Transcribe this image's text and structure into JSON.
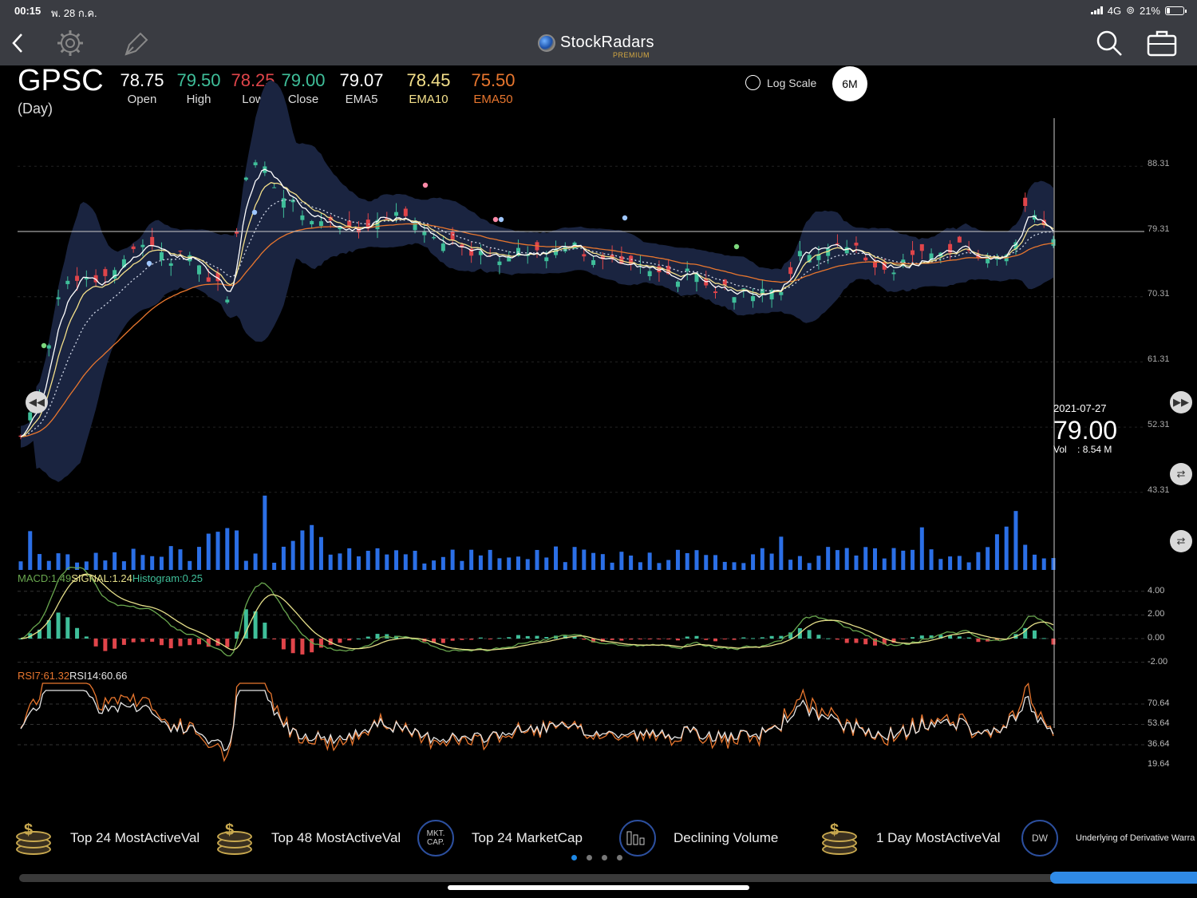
{
  "status_bar": {
    "time": "00:15",
    "date": "พ. 28 ก.ค.",
    "network": "4G",
    "battery": "21%",
    "battery_level": 0.21
  },
  "app": {
    "name": "StockRadars",
    "tier": "PREMIUM"
  },
  "quote": {
    "symbol": "GPSC",
    "period": "(Day)",
    "open": "78.75",
    "open_label": "Open",
    "high": "79.50",
    "high_label": "High",
    "low": "78.25",
    "low_label": "Low",
    "close": "79.00",
    "close_label": "Close",
    "ema5": "79.07",
    "ema5_label": "EMA5",
    "ema10": "78.45",
    "ema10_label": "EMA10",
    "ema50": "75.50",
    "ema50_label": "EMA50"
  },
  "controls": {
    "log_scale_label": "Log Scale",
    "log_scale_checked": false,
    "period": "6M"
  },
  "price_axis": {
    "ticks": [
      "88.31",
      "79.31",
      "70.31",
      "61.31",
      "52.31",
      "43.31"
    ]
  },
  "crosshair": {
    "date": "2021-07-27",
    "price": "79.00",
    "vol_label": "Vol",
    "vol_value": ": 8.54 M"
  },
  "macd": {
    "label_macd": "MACD:1.49",
    "label_signal": "SIGNAL:1.24",
    "label_hist": "Histogram:0.25",
    "ticks": [
      "4.00",
      "2.00",
      "0.00",
      "-2.00"
    ]
  },
  "rsi": {
    "label_rsi7": "RSI7:61.32",
    "label_rsi14": "RSI14:60.66",
    "ticks": [
      "70.64",
      "53.64",
      "36.64",
      "19.64"
    ]
  },
  "colors": {
    "up": "#3fbf9a",
    "down": "#e0454a",
    "ema5": "#ffffff",
    "ema10": "#f4e08a",
    "ema50": "#e8762e",
    "band": "#1a2440",
    "volume": "#2b6fe6",
    "macd_line": "#6aa84f",
    "signal_line": "#e6e08a",
    "rsi7": "#e8762e",
    "rsi14": "#e6e6e6",
    "accent": "#2f8ae6"
  },
  "screens": [
    {
      "label": "Top 24 MostActiveVal",
      "icon": "coins-icon"
    },
    {
      "label": "Top 48 MostActiveVal",
      "icon": "coins-icon"
    },
    {
      "label": "Top 24 MarketCap",
      "icon": "market-cap-icon",
      "icon_text": "MKT.\nCAP."
    },
    {
      "label": "Declining Volume",
      "icon": "volume-bars-icon"
    },
    {
      "label": "1 Day MostActiveVal",
      "icon": "coins-icon"
    },
    {
      "label": "Underlying of Derivative Warra",
      "icon": "dw-icon",
      "icon_text": "DW"
    }
  ],
  "pager": {
    "pages": 4,
    "current": 1
  }
}
